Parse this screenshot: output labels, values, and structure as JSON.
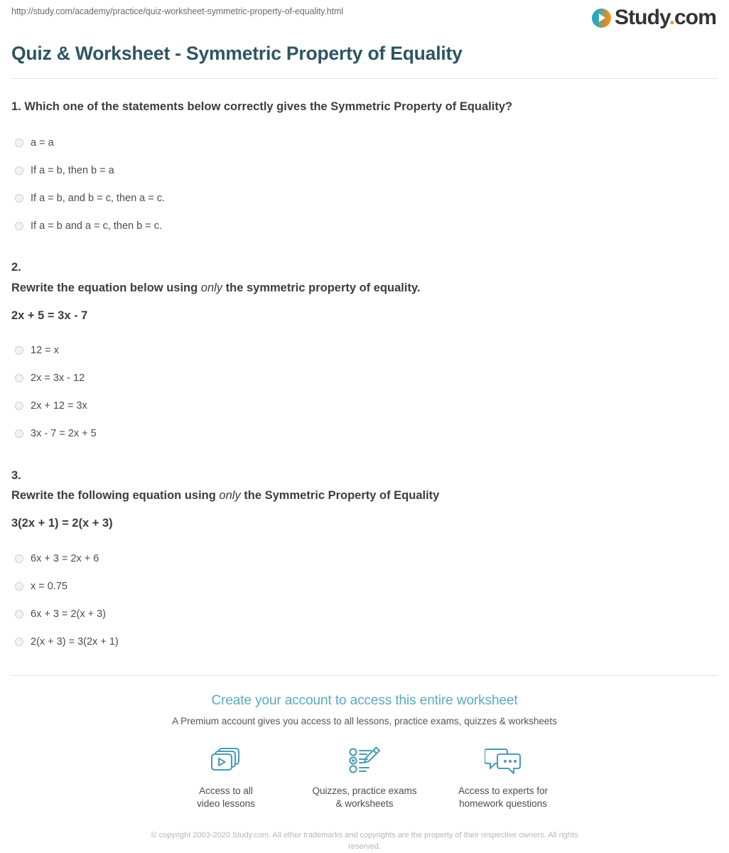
{
  "header": {
    "url": "http://study.com/academy/practice/quiz-worksheet-symmetric-property-of-equality.html",
    "logo_name": "study-com-logo",
    "logo_word": "Study",
    "logo_dot": ".",
    "logo_tld": "com",
    "logo_icon": "play-circle-icon"
  },
  "page_title": "Quiz & Worksheet - Symmetric Property of Equality",
  "questions": [
    {
      "number": "1.",
      "prompt_before": "Which one of the statements below correctly gives the Symmetric Property of Equality?",
      "prompt_italic": "",
      "prompt_after": "",
      "equation": "",
      "inline": true,
      "options": [
        "a = a",
        "If a = b, then b = a",
        "If a = b, and b = c, then a = c.",
        "If a = b and a = c, then b = c."
      ]
    },
    {
      "number": "2.",
      "prompt_before": "Rewrite the equation below using ",
      "prompt_italic": "only",
      "prompt_after": " the symmetric property of equality.",
      "equation": "2x + 5 = 3x - 7",
      "inline": false,
      "options": [
        "12 = x",
        "2x = 3x - 12",
        "2x + 12 = 3x",
        "3x - 7 = 2x + 5"
      ]
    },
    {
      "number": "3.",
      "prompt_before": "Rewrite the following equation using ",
      "prompt_italic": "only",
      "prompt_after": " the Symmetric Property of Equality",
      "equation": "3(2x + 1) = 2(x + 3)",
      "inline": false,
      "options": [
        "6x + 3 = 2x + 6",
        "x = 0.75",
        "6x + 3 = 2(x + 3)",
        "2(x + 3) = 3(2x + 1)"
      ]
    }
  ],
  "promo": {
    "link": "Create your account to access this entire worksheet",
    "subtitle": "A Premium account gives you access to all lessons, practice exams, quizzes & worksheets",
    "features": [
      {
        "icon": "video-lessons-icon",
        "text": "Access to all\nvideo lessons"
      },
      {
        "icon": "quiz-pencil-icon",
        "text": "Quizzes, practice exams\n& worksheets"
      },
      {
        "icon": "chat-bubbles-icon",
        "text": "Access to experts for\nhomework questions"
      }
    ]
  },
  "copyright": "© copyright 2003-2020 Study.com. All other trademarks and copyrights are the property of their respective owners. All rights reserved.",
  "colors": {
    "title": "#2e5561",
    "promo_link": "#5ca9c0",
    "icon_stroke": "#4a9cb5",
    "logo_accent": "#f2991f"
  }
}
